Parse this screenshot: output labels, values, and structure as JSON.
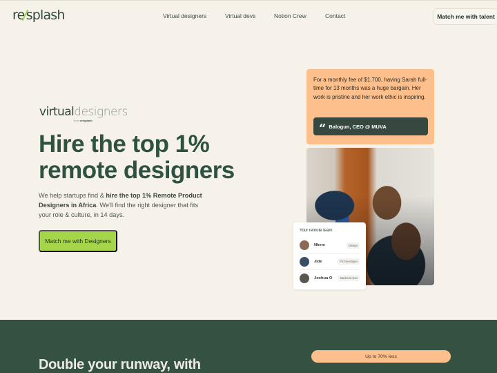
{
  "header": {
    "logo": {
      "prefix": "re",
      "slash": "/",
      "suffix": "splash"
    },
    "nav": [
      {
        "label": "Virtual designers"
      },
      {
        "label": "Virtual devs"
      },
      {
        "label": "Notion Crew"
      },
      {
        "label": "Contact"
      }
    ],
    "cta_label": "Match me with talent"
  },
  "hero": {
    "brand": {
      "virtual": "virtual",
      "designers": "designers",
      "by_prefix": "from",
      "by_brand": "re/splash"
    },
    "headline_line1": "Hire the top 1%",
    "headline_line2": "remote designers",
    "subtitle": {
      "part1": "We help startups find & ",
      "bold": "hire the top 1% Remote Product Designers in Africa",
      "part2": ". We'll find the right designer that fits your role & culture, in 14 days."
    },
    "cta_label": "Match me with Designers"
  },
  "testimonial": {
    "quote": "For a monthly fee of $1,700, having Sarah full-time for 13 months was a huge bargain. Her work is pristine and her work ethic is inspiring.",
    "quote_icon": "quote-icon",
    "author": "Balogun, CEO @ MUVA"
  },
  "team_card": {
    "title": "Your remote team",
    "members": [
      {
        "name": "Nkem",
        "role": "Design",
        "avatar_color": "#8a6a55"
      },
      {
        "name": "Jide",
        "role": "FE Developer",
        "avatar_color": "#3a4e66"
      },
      {
        "name": "Joshua O",
        "role": "Backend Dev",
        "avatar_color": "#5b5650"
      }
    ]
  },
  "section2": {
    "heading": "Double your runway, with",
    "pill": "Up to 70% less"
  },
  "colors": {
    "background": "#f6f2ea",
    "brand_green": "#2f5240",
    "accent_lime": "#a5d64a",
    "peach": "#fdc08c",
    "dark_section": "#355142"
  }
}
